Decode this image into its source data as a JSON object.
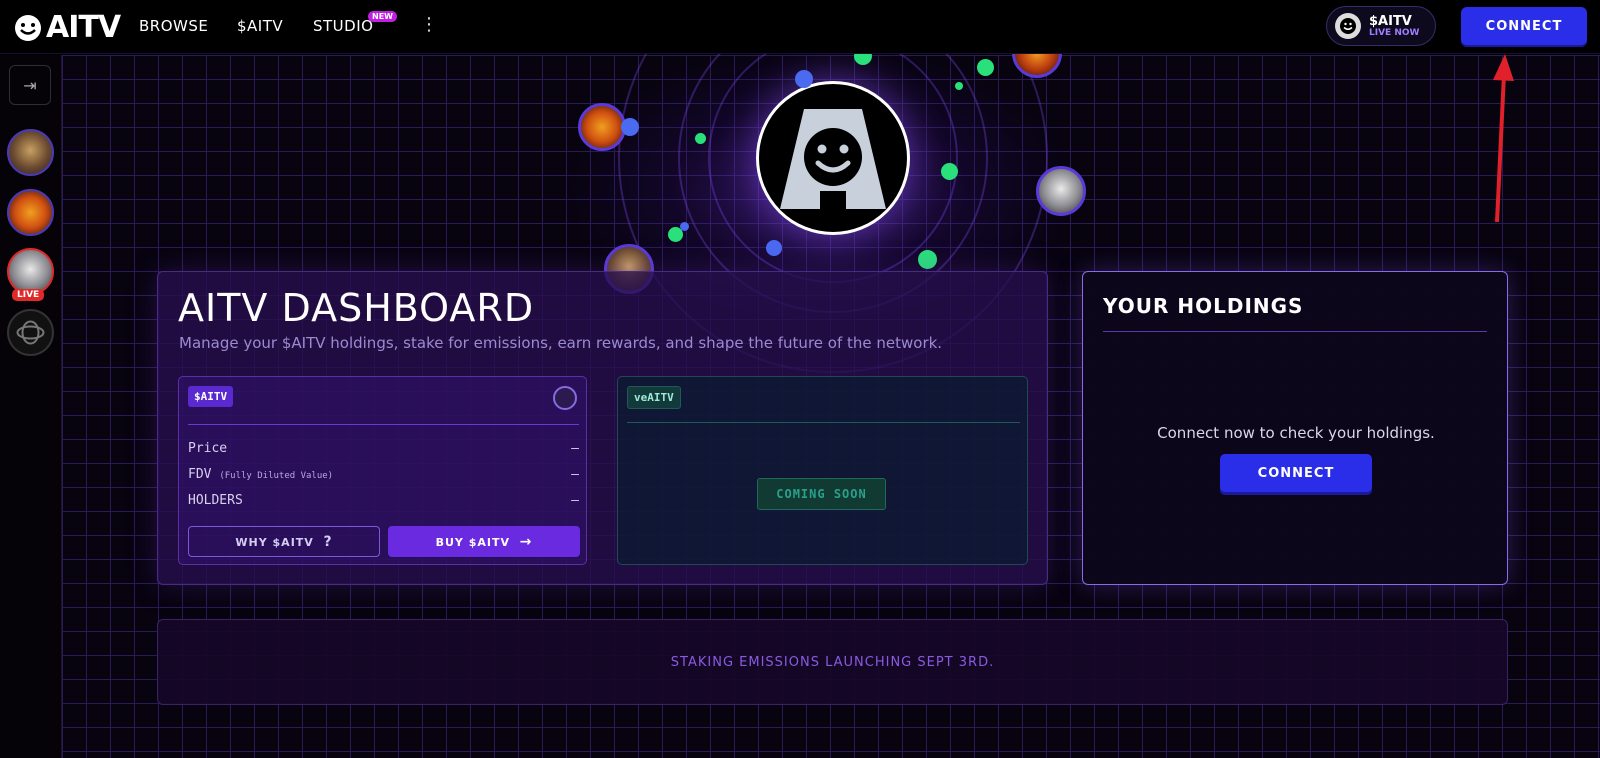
{
  "header": {
    "logo_text": "AITV",
    "nav": {
      "browse": "BROWSE",
      "aitv": "$AITV",
      "studio": "STUDIO",
      "studio_badge": "NEW"
    },
    "live_pill": {
      "title": "$AITV",
      "status": "LIVE NOW"
    },
    "connect_label": "CONNECT"
  },
  "sidebar": {
    "live_label": "LIVE"
  },
  "dashboard": {
    "title": "AITV DASHBOARD",
    "subtitle": "Manage your $AITV holdings, stake for emissions, earn rewards, and shape the future of the network.",
    "token": {
      "badge": "$AITV",
      "rows": [
        {
          "label": "Price",
          "note": "",
          "value": "—"
        },
        {
          "label": "FDV",
          "note": "(Fully Diluted Value)",
          "value": "—"
        },
        {
          "label": "HOLDERS",
          "note": "",
          "value": "—"
        }
      ],
      "why_label": "WHY $AITV",
      "why_icon": "?",
      "buy_label": "BUY $AITV",
      "buy_icon": "→"
    },
    "ve": {
      "badge": "veAITV",
      "coming_soon": "COMING SOON"
    }
  },
  "holdings": {
    "title": "YOUR HOLDINGS",
    "message": "Connect now to check your holdings.",
    "connect_label": "CONNECT"
  },
  "banner": {
    "text": "STAKING EMISSIONS LAUNCHING SEPT 3RD."
  },
  "colors": {
    "accent_blue": "#2a2ee8",
    "accent_purple": "#6a2ae0",
    "live_red": "#e02a2a",
    "annotation_red": "#e0202a"
  }
}
